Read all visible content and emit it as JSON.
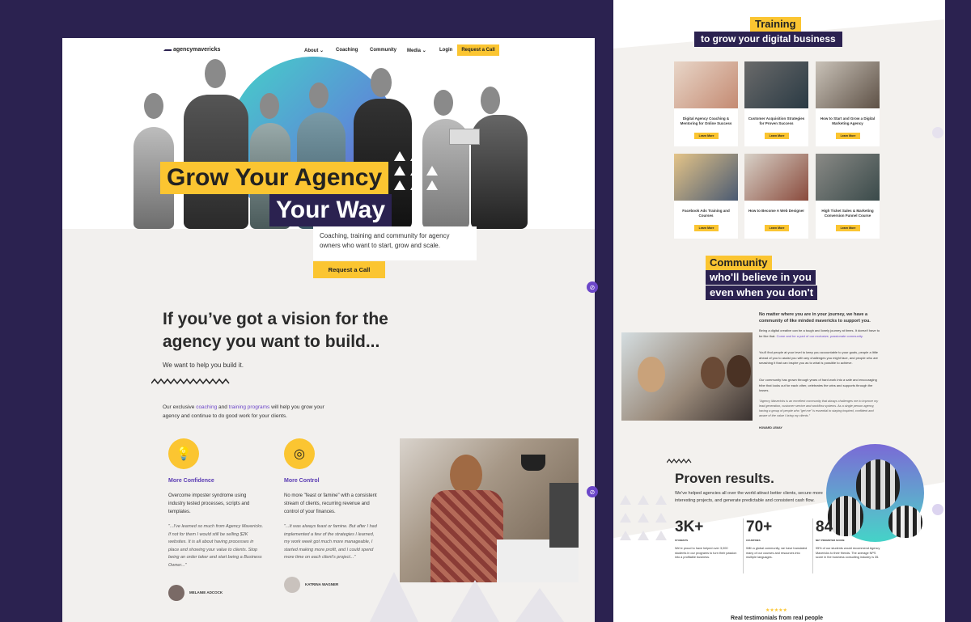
{
  "nav": {
    "logo": "agencymavericks",
    "items": [
      "About",
      "Coaching",
      "Community",
      "Media",
      "Login"
    ],
    "cta": "Request a Call"
  },
  "hero": {
    "line1": "Grow Your Agency",
    "line2": "Your Way",
    "subtitle": "Coaching, training and community for agency owners who want to start, grow and scale.",
    "cta": "Request a Call"
  },
  "vision": {
    "title": "If you’ve got a vision for the agency you want to build...",
    "subtitle": "We want to help you build it.",
    "p_before": "Our exclusive ",
    "link1": "coaching",
    "p_mid": " and ",
    "link2": "training programs",
    "p_after": " will help you grow your agency and continue to do good work for your clients."
  },
  "features": [
    {
      "icon": "lightbulb-icon",
      "title": "More Confidence",
      "desc": "Overcome imposter syndrome using industry tested processes, scripts and templates.",
      "quote": "\"...I've learned so much from Agency Mavericks. If not for them I would still be selling $2K websites. It is all about having processes in place and showing your value to clients. Stop being an order taker and start being a Business Owner...\"",
      "author": "MELANIE ADCOCK"
    },
    {
      "icon": "target-icon",
      "title": "More Control",
      "desc": "No more \"feast or famine\" with a consistent stream of clients, recurring revenue and control of your finances.",
      "quote": "\"...It was always feast or famine. But after I had implemented a few of the strategies I learned, my work week got much more manageable, I started making more profit, and I could spend more time on each client's project...\"",
      "author": "KATRINA WAGNER"
    }
  ],
  "training": {
    "tag": "Training",
    "title": "to grow your digital business",
    "cards": [
      {
        "title": "Digital Agency Coaching & Mentoring for Online Success",
        "btn": "Learn More"
      },
      {
        "title": "Customer Acquisition Strategies for Proven Success",
        "btn": "Learn More"
      },
      {
        "title": "How to Start and Grow a Digital Marketing Agency",
        "btn": "Learn More"
      },
      {
        "title": "Facebook Ads Training and Courses",
        "btn": "Learn More"
      },
      {
        "title": "How to Become A Web Designer",
        "btn": "Learn More"
      },
      {
        "title": "High Ticket Sales & Marketing Conversion Funnel Course",
        "btn": "Learn More"
      }
    ]
  },
  "community": {
    "tag": "Community",
    "line1": "who'll believe in you",
    "line2": "even when you don't",
    "lead": "No matter where you are in your journey, we have a community of like minded mavericks to support you.",
    "p1_before": "Being a digital creative can be a tough and lonely journey at times. It doesn't have to be like that. ",
    "p1_link": "Come and be a part of our exclusive, passionate community.",
    "p2": "You'll find people at your level to keep you accountable to your goals, people a little ahead of you to assist you with any challenges you might face, and people who are smashing it that can inspire you as to what is possible to achieve.",
    "p3": "Our community has grown through years of hard work into a safe and encouraging tribe that looks out for each other, celebrates the wins and supports through the losses.",
    "quote": "\"Agency Mavericks is an excellent community that always challenges me to improve my lead generation, customer service and workflow systems. As a single person agency, having a group of people who \"get me\" is essential to staying inspired, confident and aware of the value I bring my clients.\"",
    "author": "HOWARD LEMAY"
  },
  "results": {
    "title": "Proven results.",
    "desc": "We've helped agencies all over the world attract better clients, secure more interesting projects, and generate predictable and consistent cash flow.",
    "stats": [
      {
        "value": "3K+",
        "label": "STUDENTS",
        "desc": "We're proud to have helped over 3,000 students in our programs to turn their passion into a profitable business."
      },
      {
        "value": "70+",
        "label": "COUNTRIES",
        "desc": "With a global community, we have translated many of our courses and resources into multiple languages."
      },
      {
        "value": "84",
        "label": "NET PROMOTER SCORE",
        "desc": "95% of our students would recommend Agency Mavericks to their friends. The average NPS score in the business consulting industry is 35."
      }
    ]
  },
  "testimonials": {
    "stars": "★★★★★",
    "title": "Real testimonials from real people"
  }
}
